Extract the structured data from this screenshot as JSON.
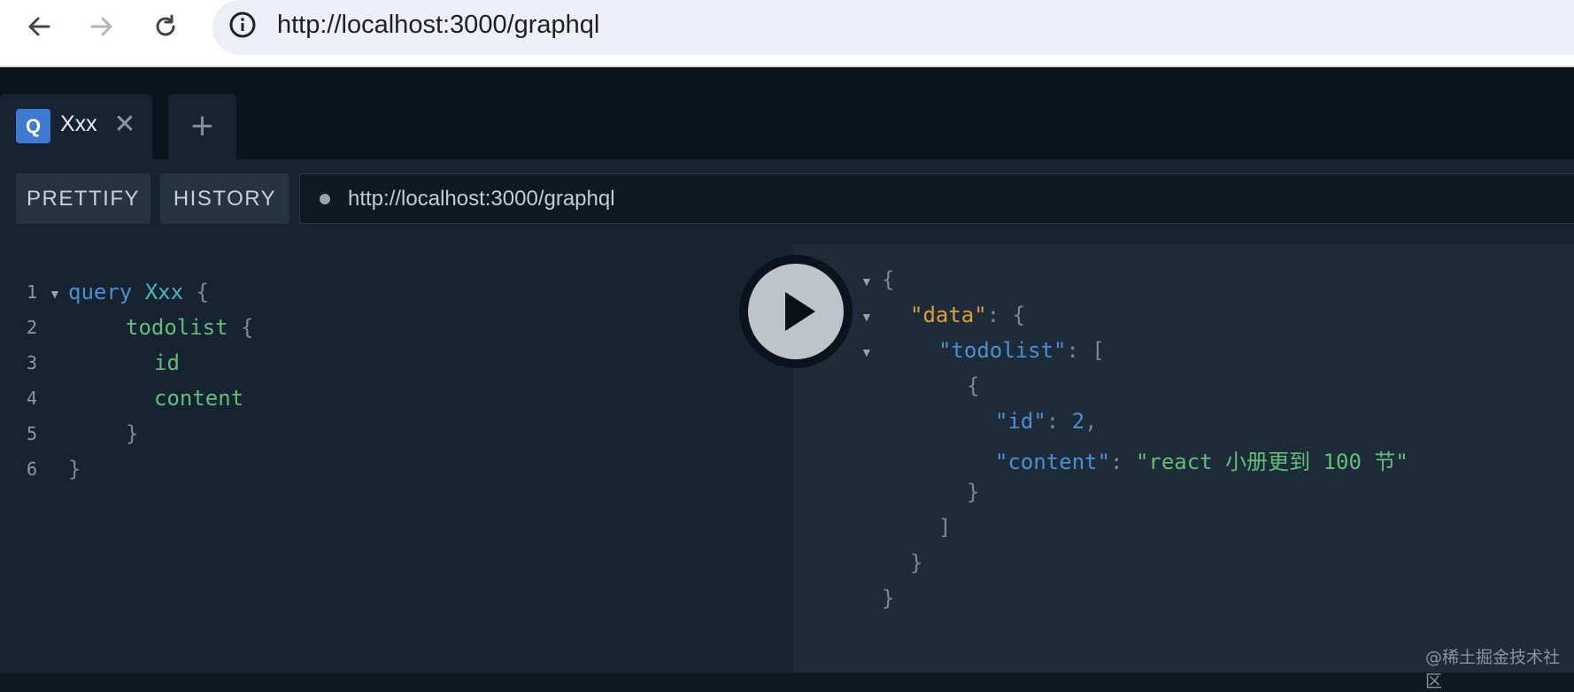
{
  "browser": {
    "url": "http://localhost:3000/graphql"
  },
  "tabs": [
    {
      "badge": "Q",
      "title": "Xxx",
      "close": "✕"
    }
  ],
  "add_tab_label": "+",
  "toolbar": {
    "prettify": "PRETTIFY",
    "history": "HISTORY",
    "endpoint": "http://localhost:3000/graphql"
  },
  "query_lines": [
    "1",
    "2",
    "3",
    "4",
    "5",
    "6"
  ],
  "query": {
    "keyword": "query",
    "name": "Xxx",
    "field": "todolist",
    "subfields": [
      "id",
      "content"
    ]
  },
  "result": {
    "data_key": "\"data\"",
    "todolist_key": "\"todolist\"",
    "id_key": "\"id\"",
    "id_value": "2",
    "content_key": "\"content\"",
    "content_value": "\"react 小册更到 100 节\""
  },
  "watermark": "@稀土掘金技术社区"
}
